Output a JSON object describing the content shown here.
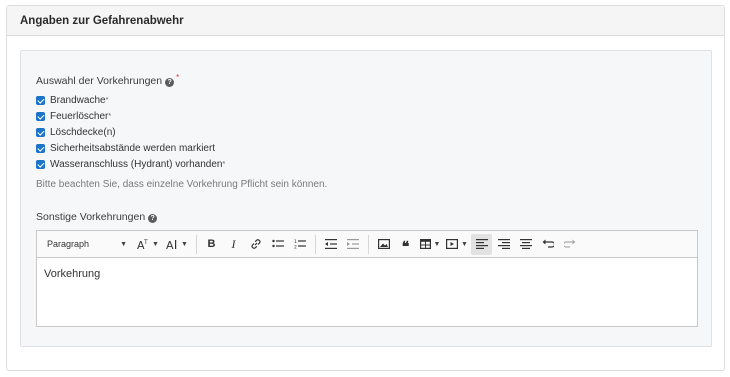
{
  "panel": {
    "title": "Angaben zur Gefahrenabwehr"
  },
  "measures": {
    "label": "Auswahl der Vorkehrungen",
    "required_mark": "*",
    "options": [
      {
        "label": "Brandwache",
        "mark": "*",
        "checked": true
      },
      {
        "label": "Feuerlöscher",
        "mark": "*",
        "checked": true
      },
      {
        "label": "Löschdecke(n)",
        "mark": "",
        "checked": true
      },
      {
        "label": "Sicherheitsabstände werden markiert",
        "mark": "",
        "checked": true
      },
      {
        "label": "Wasseranschluss (Hydrant) vorhanden",
        "mark": "*",
        "checked": true
      }
    ],
    "hint": "Bitte beachten Sie, dass einzelne Vorkehrung Pflicht sein können."
  },
  "other": {
    "label": "Sonstige Vorkehrungen",
    "editor": {
      "heading_select": "Paragraph",
      "content": "Vorkehrung"
    }
  },
  "colors": {
    "checkbox": "#1a73c8",
    "required": "#dd3333",
    "inner_bg": "#f6f7f8"
  }
}
